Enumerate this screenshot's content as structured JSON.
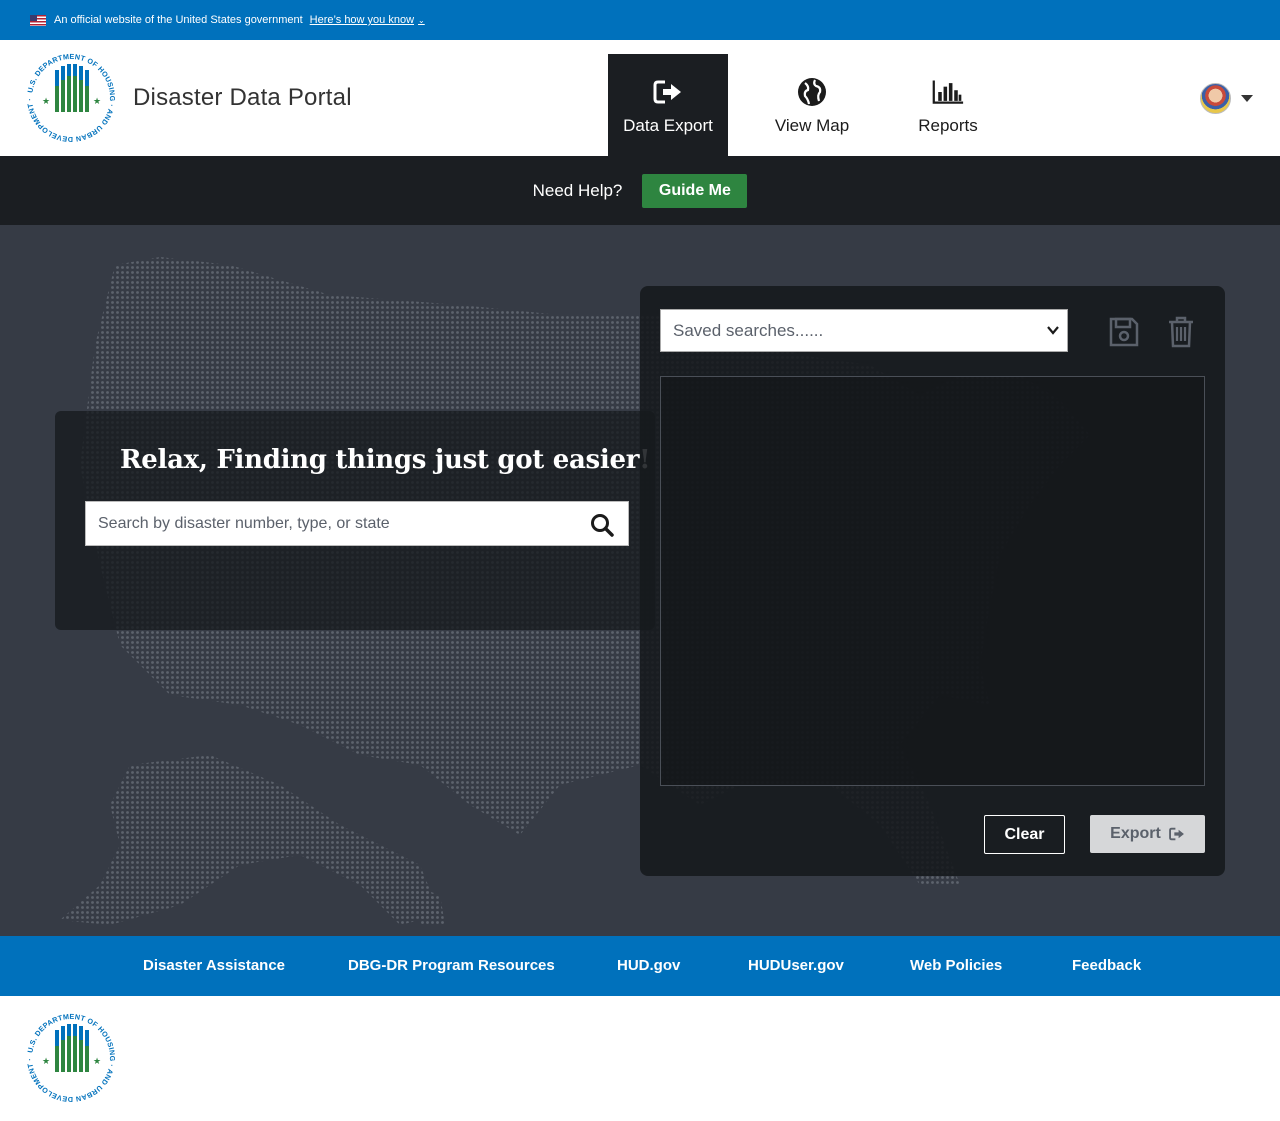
{
  "gov_banner": {
    "text": "An official website of the United States government",
    "link": "Here’s how you know"
  },
  "header": {
    "title": "Disaster Data Portal",
    "logo_text": "U.S. DEPARTMENT OF HOUSING AND URBAN DEVELOPMENT",
    "nav": [
      {
        "label": "Data Export",
        "icon": "sign-out-icon",
        "active": true
      },
      {
        "label": "View Map",
        "icon": "globe-icon",
        "active": false
      },
      {
        "label": "Reports",
        "icon": "bar-chart-icon",
        "active": false
      }
    ]
  },
  "help": {
    "text": "Need Help?",
    "button": "Guide Me"
  },
  "search": {
    "tagline": "Relax, Finding things just got easier!",
    "placeholder": "Search by disaster number, type, or state"
  },
  "export_panel": {
    "saved_placeholder": "Saved searches......",
    "clear_label": "Clear",
    "export_label": "Export"
  },
  "footer": {
    "links": [
      "Disaster Assistance",
      "DBG-DR Program Resources",
      "HUD.gov",
      "HUDUser.gov",
      "Web Policies",
      "Feedback"
    ]
  },
  "colors": {
    "gov_blue": "#0071bc",
    "dark": "#1b1e22",
    "green": "#2e8540",
    "map_bg": "#363b45"
  }
}
